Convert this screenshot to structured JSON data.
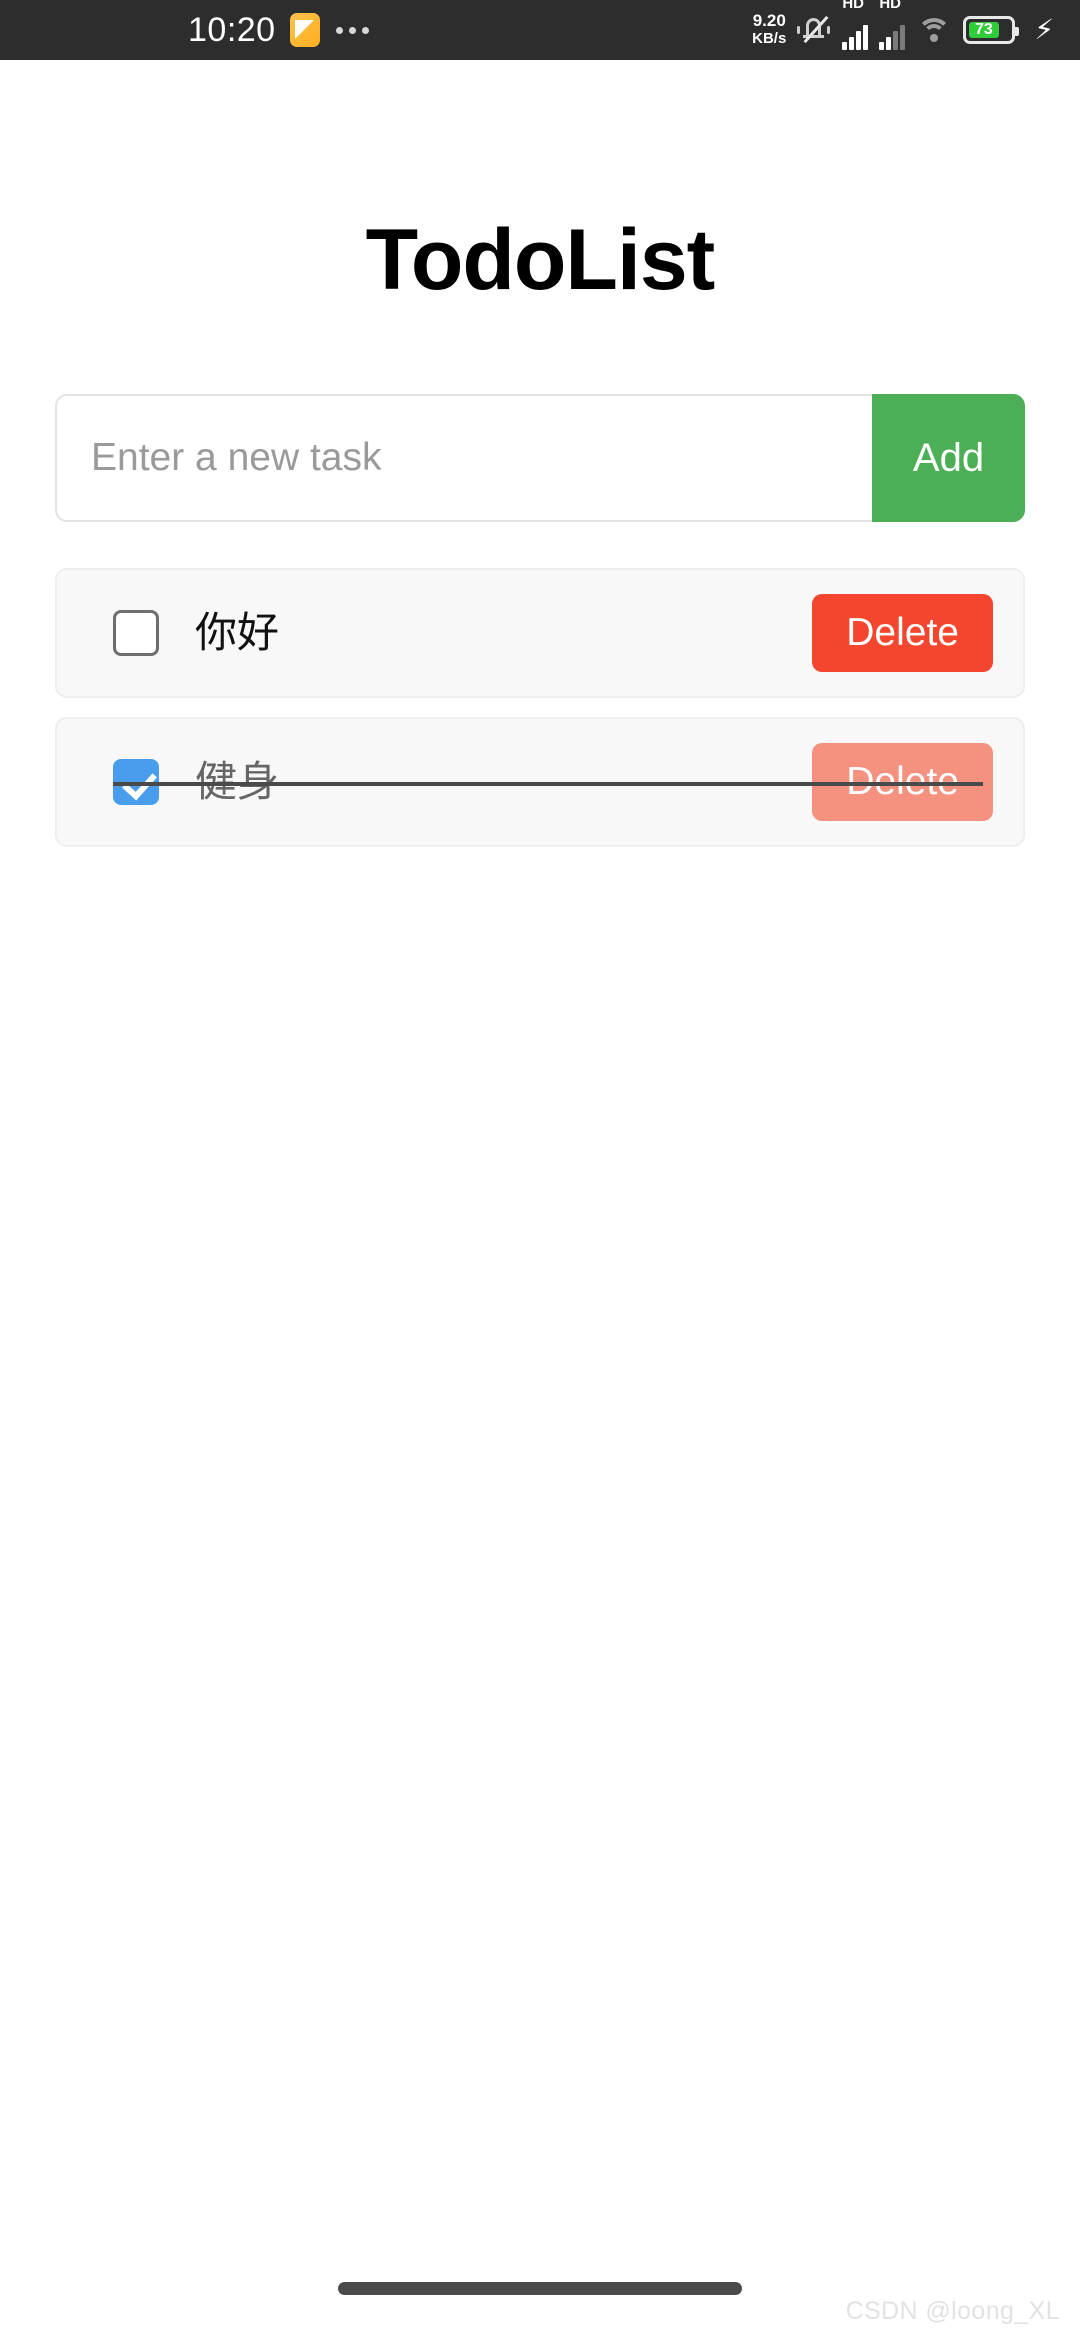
{
  "status_bar": {
    "clock": "10:20",
    "notification_icon": "notes-app-icon",
    "overflow_icon": "more-notifications-dots",
    "net_speed_value": "9.20",
    "net_speed_unit": "KB/s",
    "mute_icon": "bell-muted-icon",
    "sim1_label": "HD",
    "sim2_label": "HD",
    "wifi_icon": "wifi-icon",
    "battery_percent": "73",
    "battery_level": 73,
    "charging_icon": "lightning-bolt-icon",
    "background_color": "#2d2d2d"
  },
  "app": {
    "title": "TodoList",
    "input": {
      "value": "",
      "placeholder": "Enter a new task"
    },
    "add_button_label": "Add",
    "accent_colors": {
      "add_green": "#4caf55",
      "delete_red": "#f4452e",
      "delete_red_faded": "#f4917f",
      "checkbox_blue": "#4a9dec"
    },
    "tasks": [
      {
        "label": "你好",
        "completed": false,
        "delete_label": "Delete"
      },
      {
        "label": "健身",
        "completed": true,
        "delete_label": "Delete"
      }
    ]
  },
  "watermark": "CSDN @loong_XL"
}
